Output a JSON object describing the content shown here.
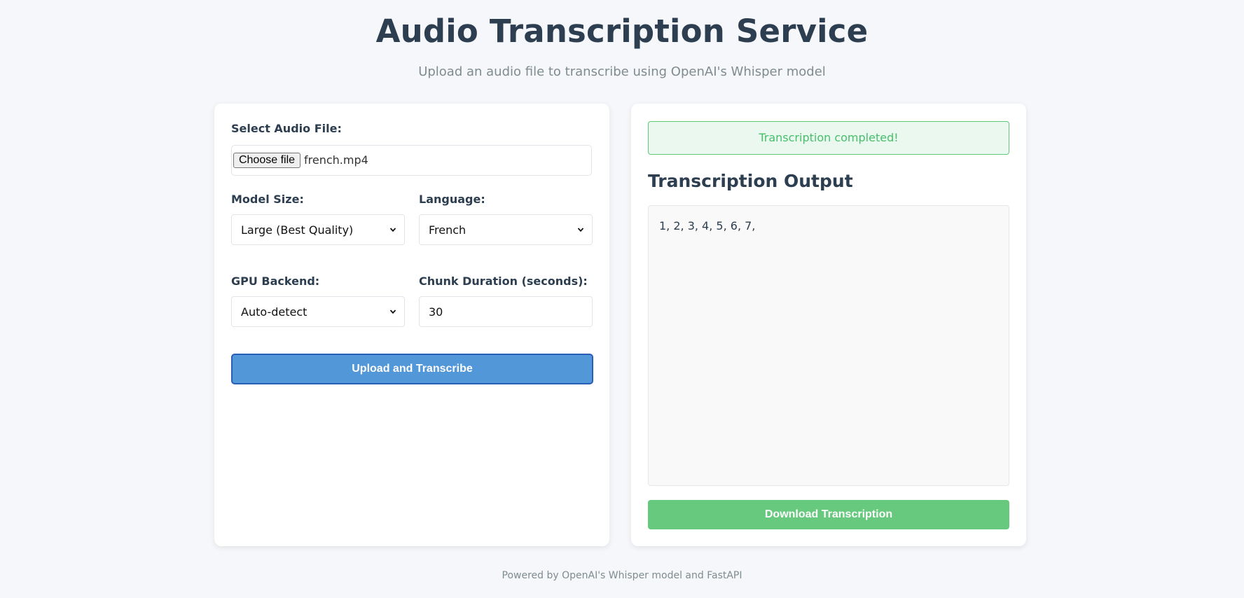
{
  "header": {
    "title": "Audio Transcription Service",
    "subtitle": "Upload an audio file to transcribe using OpenAI's Whisper model"
  },
  "form": {
    "file_label": "Select Audio File:",
    "choose_file_label": "Choose file",
    "file_name": "french.mp4",
    "model_label": "Model Size:",
    "model_value": "Large (Best Quality)",
    "language_label": "Language:",
    "language_value": "French",
    "gpu_label": "GPU Backend:",
    "gpu_value": "Auto-detect",
    "chunk_label": "Chunk Duration (seconds):",
    "chunk_value": "30",
    "upload_button": "Upload and Transcribe"
  },
  "result": {
    "status": "Transcription completed!",
    "title": "Transcription Output",
    "text": "1, 2, 3, 4, 5, 6, 7,",
    "download_button": "Download Transcription"
  },
  "footer": {
    "text": "Powered by OpenAI's Whisper model and FastAPI"
  },
  "colors": {
    "background": "#f5f7fa",
    "primary": "#5297d8",
    "success": "#66c97d",
    "text": "#2c3e50",
    "muted": "#7f8c8d"
  },
  "icons": {
    "select_arrow": "chevron-down-icon"
  }
}
